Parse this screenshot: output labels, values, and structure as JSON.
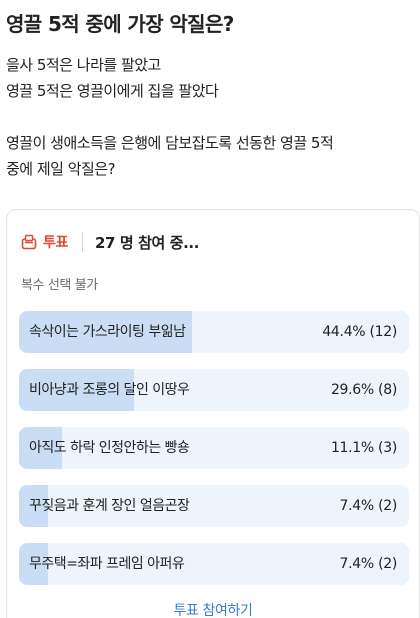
{
  "post": {
    "title": "영끌 5적 중에 가장 악질은?",
    "lines": [
      "을사 5적은 나라를 팔았고",
      "영끌 5적은 영끌이에게 집을 팔았다",
      "영끌이 생애소득을 은행에 담보잡도록 선동한 영끌 5적",
      "중에 제일 악질은?"
    ]
  },
  "poll": {
    "tag": "투표",
    "participants": "27 명 참여 중...",
    "note": "복수 선택 불가",
    "options": [
      {
        "label": "속삭이는 가스라이팅 부읾남",
        "percent": 44.4,
        "result": "44.4% (12)"
      },
      {
        "label": "비아냥과 조롱의 달인 이땅우",
        "percent": 29.6,
        "result": "29.6% (8)"
      },
      {
        "label": "아직도 하락 인정안하는 빵숑",
        "percent": 11.1,
        "result": "11.1% (3)"
      },
      {
        "label": "꾸짖음과 훈계 장인 얼음곤장",
        "percent": 7.4,
        "result": "7.4% (2)"
      },
      {
        "label": "무주택=좌파 프레임 아퍼유",
        "percent": 7.4,
        "result": "7.4% (2)"
      }
    ],
    "action_label": "투표 참여하기",
    "colors": {
      "accent": "#e8452e",
      "bar_fill": "#c9def4",
      "bar_track": "#eef4fb",
      "link": "#3a7bd5"
    },
    "icon": "ballot-box-icon"
  }
}
